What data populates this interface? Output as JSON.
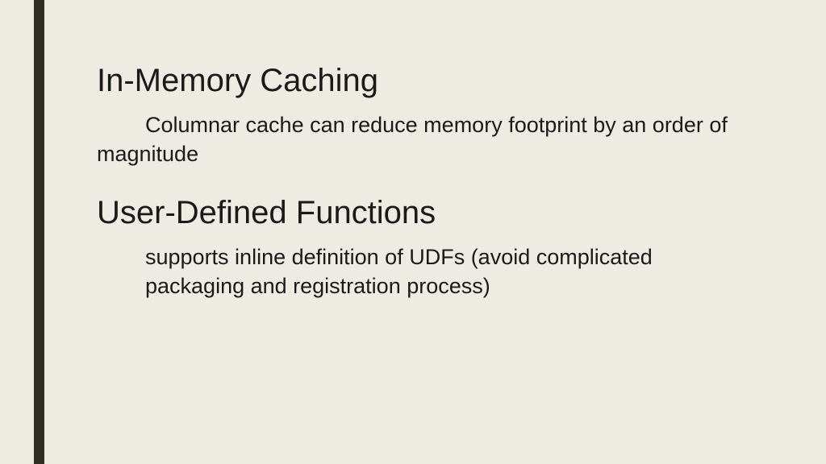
{
  "sections": [
    {
      "heading": "In-Memory Caching",
      "body": "Columnar cache can reduce memory footprint by an order of magnitude"
    },
    {
      "heading": "User-Defined Functions",
      "body": "supports inline definition of UDFs (avoid complicated  packaging and registration process)"
    }
  ]
}
